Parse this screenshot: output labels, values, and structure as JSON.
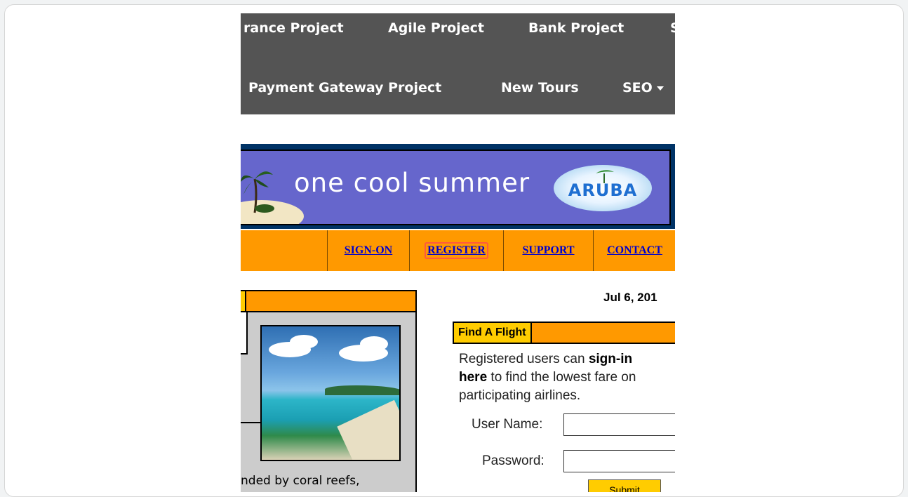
{
  "topnav": {
    "row1": [
      "rance Project",
      "Agile Project",
      "Bank Project",
      "S"
    ],
    "row2": [
      "Payment Gateway Project",
      "New Tours"
    ],
    "seo_label": "SEO"
  },
  "banner": {
    "tagline": "one cool summer",
    "brand": "ARUBA"
  },
  "menu": {
    "items": [
      "SIGN-ON",
      "REGISTER",
      "SUPPORT",
      "CONTACT"
    ]
  },
  "left_panel": {
    "caption": "nded by coral reefs,"
  },
  "date_text": "Jul 6, 201",
  "find_flight": {
    "title": "Find A Flight",
    "desc_prefix": "Registered users can ",
    "desc_bold1": "sign-in",
    "desc_bold2": "here",
    "desc_suffix": " to find the lowest fare on participating airlines.",
    "username_label": "User Name:",
    "username_value": "",
    "password_label": "Password:",
    "password_value": "",
    "submit_label": "Submit"
  },
  "colors": {
    "nav_bg": "#545454",
    "banner_bg": "#6666cc",
    "menu_bg": "#ff9900",
    "tab_bg": "#ffcc00",
    "highlight": "#ff5a3c"
  }
}
